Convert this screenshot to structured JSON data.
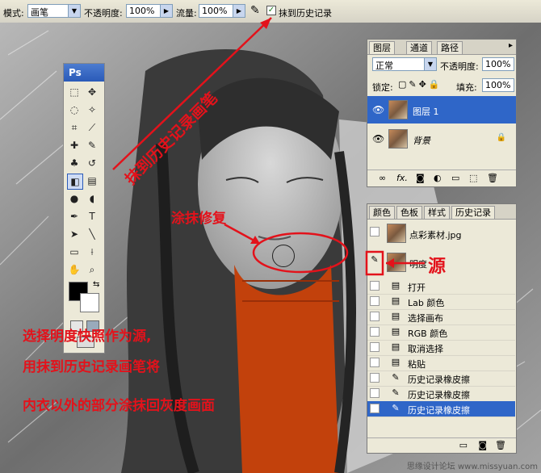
{
  "options_bar": {
    "mode_label": "模式:",
    "mode_value": "画笔",
    "opacity_label": "不透明度:",
    "opacity_value": "100%",
    "flow_label": "流量:",
    "flow_value": "100%",
    "erase_history_label": "抹到历史记录",
    "erase_history_checked": true
  },
  "toolbox": {
    "logo": "Ps"
  },
  "layers_panel": {
    "tabs": [
      "图层",
      "通道",
      "路径"
    ],
    "blend_mode": "正常",
    "opacity_label": "不透明度:",
    "opacity_value": "100%",
    "lock_label": "锁定:",
    "fill_label": "填充:",
    "fill_value": "100%",
    "layers": [
      {
        "name": "图层 1",
        "selected": true
      },
      {
        "name": "背景",
        "selected": false
      }
    ]
  },
  "history_panel": {
    "tabs": [
      "颜色",
      "色板",
      "样式",
      "历史记录"
    ],
    "snapshots": [
      {
        "name": "点彩素材.jpg"
      },
      {
        "name": "明度"
      }
    ],
    "states": [
      {
        "name": "打开",
        "icon": "doc-icon"
      },
      {
        "name": "Lab 颜色",
        "icon": "doc-icon"
      },
      {
        "name": "选择画布",
        "icon": "doc-icon"
      },
      {
        "name": "RGB 颜色",
        "icon": "doc-icon"
      },
      {
        "name": "取消选择",
        "icon": "doc-icon"
      },
      {
        "name": "粘贴",
        "icon": "doc-icon"
      },
      {
        "name": "历史记录橡皮擦",
        "icon": "brush-icon"
      },
      {
        "name": "历史记录橡皮擦",
        "icon": "brush-icon"
      },
      {
        "name": "历史记录橡皮擦",
        "icon": "brush-icon",
        "selected": true
      }
    ]
  },
  "annotations": {
    "diagonal": "抹到历史记录画笔",
    "smear": "涂抹修复",
    "source": "源",
    "line1": "选择明度快照作为源,",
    "line2": "用抹到历史记录画笔将",
    "line3": "内衣以外的部分涂抹回灰度画面"
  },
  "watermark": "思缘设计论坛 www.missyuan.com",
  "colors": {
    "annotation_red": "#e3121b",
    "selection_blue": "#2f66c8",
    "sweater_orange": "#c2410c"
  }
}
